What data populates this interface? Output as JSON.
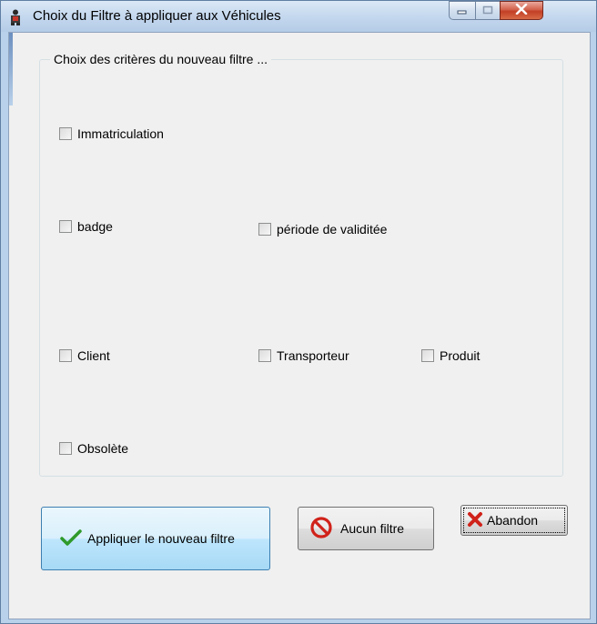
{
  "window": {
    "title": "Choix du Filtre à appliquer aux Véhicules",
    "app_icon": "person-icon",
    "controls": [
      "minimize-icon",
      "maximize-icon",
      "close-icon"
    ]
  },
  "group": {
    "title": "Choix des critères du nouveau filtre ..."
  },
  "criteria": {
    "immatriculation": {
      "label": "Immatriculation",
      "checked": false
    },
    "badge": {
      "label": "badge",
      "checked": false
    },
    "periode": {
      "label": "période de validitée",
      "checked": false
    },
    "client": {
      "label": "Client",
      "checked": false
    },
    "transporteur": {
      "label": "Transporteur",
      "checked": false
    },
    "produit": {
      "label": "Produit",
      "checked": false
    },
    "obsolete": {
      "label": "Obsolète",
      "checked": false
    }
  },
  "buttons": {
    "apply": {
      "label": "Appliquer le nouveau filtre",
      "icon": "checkmark-icon"
    },
    "none": {
      "label": "Aucun filtre",
      "icon": "no-entry-icon"
    },
    "abandon": {
      "label": "Abandon",
      "icon": "red-x-icon"
    }
  },
  "colors": {
    "title_bar": "#c4d8ee",
    "close_button": "#c23f25",
    "apply_button_border": "#3c7fb1",
    "check_green": "#2f9a2b"
  }
}
